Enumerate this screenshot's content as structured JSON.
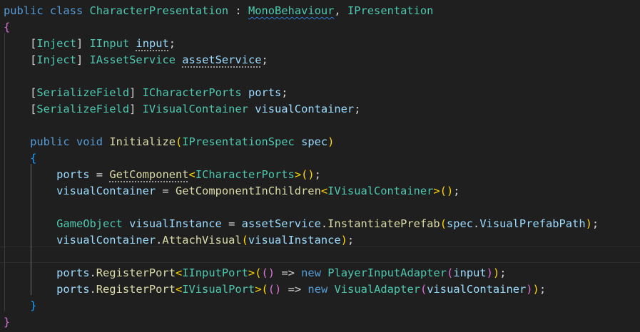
{
  "editor": {
    "language": "C#",
    "class_name": "CharacterPresentation",
    "lines": [
      "public class CharacterPresentation : MonoBehaviour, IPresentation",
      "{",
      "    [Inject] IInput input;",
      "    [Inject] IAssetService assetService;",
      "",
      "    [SerializeField] ICharacterPorts ports;",
      "    [SerializeField] IVisualContainer visualContainer;",
      "",
      "    public void Initialize(IPresentationSpec spec)",
      "    {",
      "        ports = GetComponent<ICharacterPorts>();",
      "        visualContainer = GetComponentInChildren<IVisualContainer>();",
      "",
      "        GameObject visualInstance = assetService.InstantiatePrefab(spec.VisualPrefabPath);",
      "        visualContainer.AttachVisual(visualInstance);",
      "",
      "        ports.RegisterPort<IInputPort>(() => new PlayerInputAdapter(input));",
      "        ports.RegisterPort<IVisualPort>(() => new VisualAdapter(visualContainer));",
      "    }",
      "}"
    ]
  },
  "colors": {
    "background": "#1f1f1f",
    "keyword": "#569cd6",
    "type": "#4ec9b0",
    "function": "#dcdcaa",
    "variable": "#9cdcfe",
    "bracket_level_1": "#ffd700",
    "bracket_level_2": "#da70d6",
    "bracket_level_3": "#179fff"
  }
}
